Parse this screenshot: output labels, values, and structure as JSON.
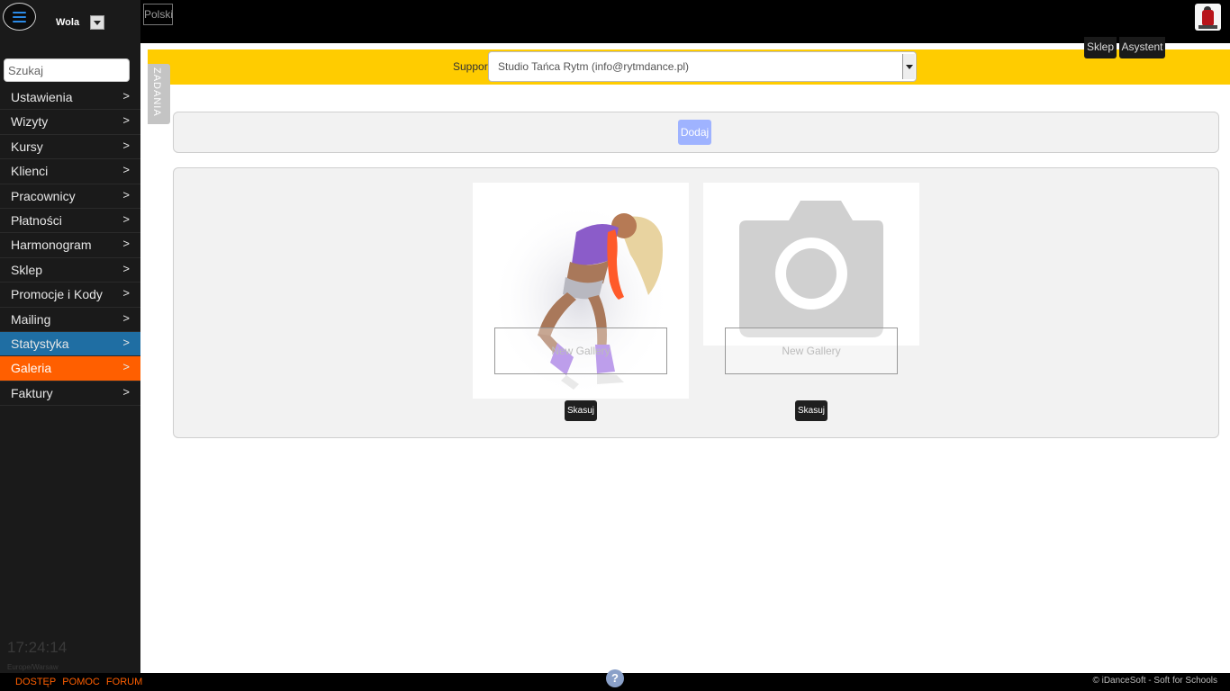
{
  "sidebar": {
    "branch": "Wola",
    "search_placeholder": "Szukaj",
    "items": [
      {
        "label": "Ustawienia",
        "chevron": ">"
      },
      {
        "label": "Wizyty",
        "chevron": ">"
      },
      {
        "label": "Kursy",
        "chevron": ">"
      },
      {
        "label": "Klienci",
        "chevron": ">"
      },
      {
        "label": "Pracownicy",
        "chevron": ">"
      },
      {
        "label": "Płatności",
        "chevron": ">"
      },
      {
        "label": "Harmonogram",
        "chevron": ">"
      },
      {
        "label": "Sklep",
        "chevron": ">"
      },
      {
        "label": "Promocje i Kody",
        "chevron": ">"
      },
      {
        "label": "Mailing",
        "chevron": ">"
      },
      {
        "label": "Statystyka",
        "chevron": ">"
      },
      {
        "label": "Galeria",
        "chevron": ">"
      },
      {
        "label": "Faktury",
        "chevron": ">"
      }
    ],
    "clock": "17:24:14",
    "timezone": "Europe/Warsaw"
  },
  "topbar": {
    "language": "Polski",
    "sklep": "Sklep",
    "asystent": "Asystent"
  },
  "support": {
    "label": "Support",
    "selected": "Studio Tańca Rytm (info@rytmdance.pl)"
  },
  "zadania": "ZADANIA",
  "toolbar": {
    "add": "Dodaj"
  },
  "galleries": [
    {
      "title": "New Gallery",
      "delete": "Skasuj"
    },
    {
      "title": "New Gallery",
      "delete": "Skasuj"
    }
  ],
  "footer": {
    "links": [
      "DOSTĘP",
      "POMOC",
      "FORUM"
    ],
    "help": "?",
    "copyright": "© iDanceSoft - Soft for Schools"
  },
  "colors": {
    "accent_orange": "#ff5f00",
    "accent_blue": "#1f6ea3",
    "support_yellow": "#ffcc00"
  }
}
